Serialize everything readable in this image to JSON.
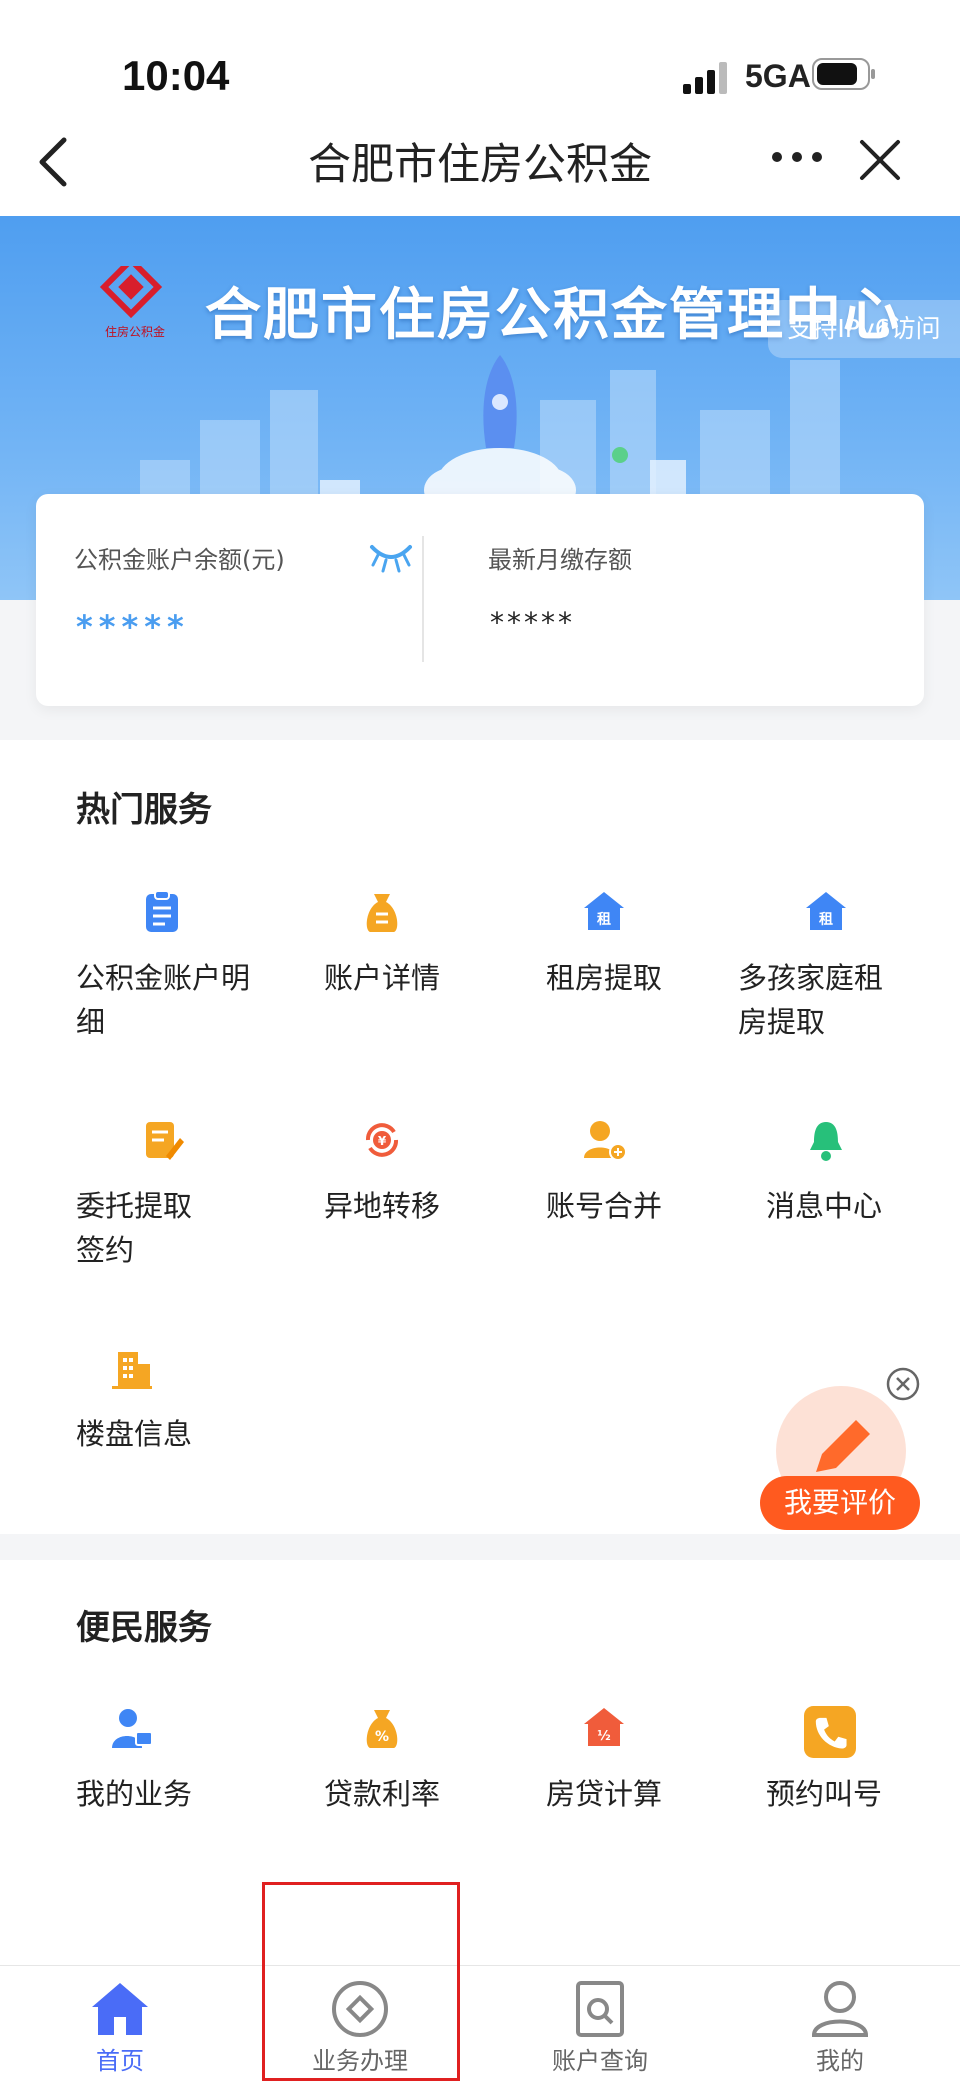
{
  "status_bar": {
    "time": "10:04",
    "network": "5GA"
  },
  "nav": {
    "title": "合肥市住房公积金"
  },
  "banner": {
    "title": "合肥市住房公积金管理中心",
    "ipv6_badge": "支持IPv6访问",
    "logo_text": "住房公积金"
  },
  "account_card": {
    "balance_label": "公积金账户余额(元)",
    "balance_value": "*****",
    "monthly_label": "最新月缴存额",
    "monthly_value": "*****"
  },
  "hot_services": {
    "title": "热门服务",
    "items": [
      {
        "label": "公积金账户明细",
        "icon": "clipboard-icon",
        "color": "#3f86f5"
      },
      {
        "label": "账户详情",
        "icon": "money-bag-icon",
        "color": "#f5a623"
      },
      {
        "label": "租房提取",
        "icon": "house-rent-icon",
        "color": "#3f86f5"
      },
      {
        "label": "多孩家庭租房提取",
        "icon": "house-rent-icon",
        "color": "#3f86f5"
      },
      {
        "label": "委托提取签约",
        "icon": "contract-icon",
        "color": "#f5a623"
      },
      {
        "label": "异地转移",
        "icon": "transfer-icon",
        "color": "#f05c3b"
      },
      {
        "label": "账号合并",
        "icon": "user-add-icon",
        "color": "#f5a623"
      },
      {
        "label": "消息中心",
        "icon": "bell-icon",
        "color": "#27c07a"
      },
      {
        "label": "楼盘信息",
        "icon": "building-icon",
        "color": "#f5a623"
      }
    ]
  },
  "convenience_services": {
    "title": "便民服务",
    "items": [
      {
        "label": "我的业务",
        "icon": "user-briefcase-icon",
        "color": "#3f86f5"
      },
      {
        "label": "贷款利率",
        "icon": "percent-bag-icon",
        "color": "#f5a623"
      },
      {
        "label": "房贷计算",
        "icon": "house-calc-icon",
        "color": "#f05c3b"
      },
      {
        "label": "预约叫号",
        "icon": "phone-icon",
        "color": "#f5a623"
      }
    ]
  },
  "rating": {
    "label": "我要评价"
  },
  "tabbar": {
    "items": [
      {
        "label": "首页",
        "icon": "home-icon",
        "active": true
      },
      {
        "label": "业务办理",
        "icon": "business-icon",
        "active": false
      },
      {
        "label": "账户查询",
        "icon": "account-query-icon",
        "active": false
      },
      {
        "label": "我的",
        "icon": "profile-icon",
        "active": false
      }
    ],
    "active_color": "#4a6cf7"
  }
}
